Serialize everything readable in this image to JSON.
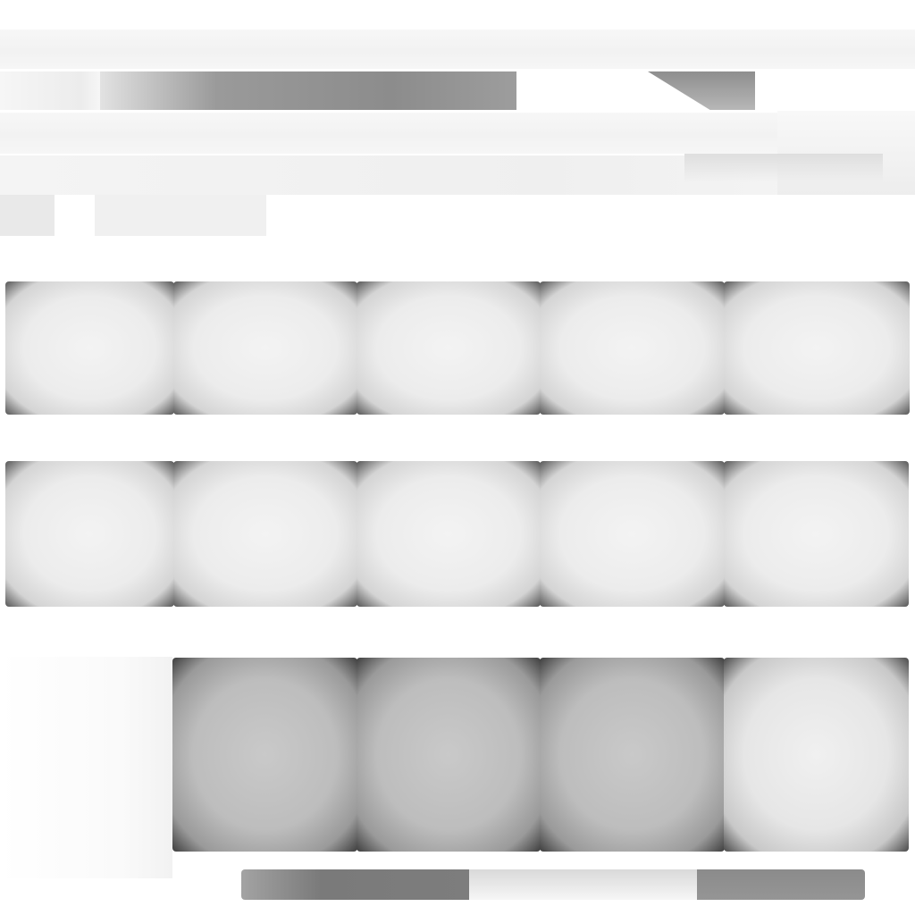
{
  "header": {
    "title": "",
    "tab_left": "",
    "tab_right": ""
  },
  "grid": {
    "rows": [
      {
        "cells": [
          "",
          "",
          "",
          "",
          ""
        ]
      },
      {
        "cells": [
          "",
          "",
          "",
          "",
          ""
        ]
      },
      {
        "cells": [
          "",
          "",
          "",
          ""
        ]
      }
    ]
  },
  "footer": {
    "segments": [
      "",
      "",
      ""
    ]
  },
  "colors": {
    "background": "#ffffff",
    "band": "#f2f2f2",
    "accent_dark": "#8c8c8c",
    "cell_edge": "#565656"
  }
}
